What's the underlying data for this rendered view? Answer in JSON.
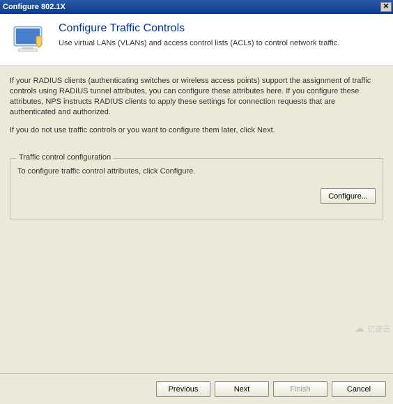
{
  "titlebar": {
    "title": "Configure 802.1X",
    "close_label": "✕"
  },
  "header": {
    "heading": "Configure Traffic Controls",
    "subheading": "Use virtual LANs (VLANs) and access control lists (ACLs) to control network traffic."
  },
  "body": {
    "paragraph1": "If your RADIUS clients (authenticating switches or wireless access points) support the assignment of traffic controls using RADIUS tunnel attributes, you can configure these attributes here. If you configure these attributes, NPS instructs RADIUS clients to apply these settings for connection requests that are authenticated and authorized.",
    "paragraph2": "If you do not use traffic controls or you want to configure them later, click Next."
  },
  "groupbox": {
    "legend": "Traffic control configuration",
    "text": "To configure traffic control attributes, click Configure.",
    "configure_label": "Configure..."
  },
  "footer": {
    "previous_label": "Previous",
    "next_label": "Next",
    "finish_label": "Finish",
    "cancel_label": "Cancel"
  },
  "watermark": {
    "text": "亿速云"
  }
}
